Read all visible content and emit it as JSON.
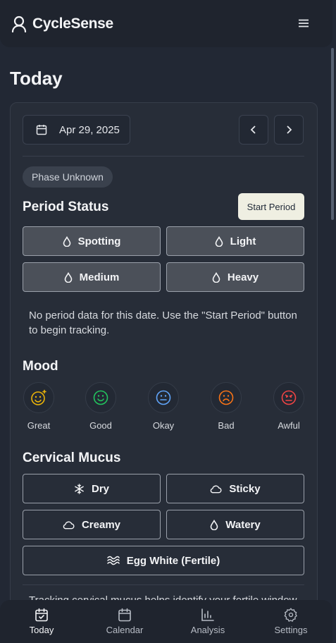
{
  "app": {
    "name": "CycleSense"
  },
  "icons": {
    "logo": "user-icon",
    "menu": "hamburger-icon",
    "calendar": "calendar-icon",
    "prev": "chevron-left-icon",
    "next": "chevron-right-icon",
    "drop": "droplet-icon",
    "snow": "snowflake-icon",
    "cloud": "cloud-icon",
    "waves": "waves-icon"
  },
  "page": {
    "title": "Today"
  },
  "date_selector": {
    "value": "Apr 29, 2025"
  },
  "phase": {
    "label": "Phase Unknown"
  },
  "period": {
    "title": "Period Status",
    "start_button": "Start Period",
    "options": [
      "Spotting",
      "Light",
      "Medium",
      "Heavy"
    ],
    "empty_message": "No period data for this date. Use the \"Start Period\" button to begin tracking."
  },
  "mood": {
    "title": "Mood",
    "options": [
      {
        "label": "Great",
        "color": "#eab308"
      },
      {
        "label": "Good",
        "color": "#22c55e"
      },
      {
        "label": "Okay",
        "color": "#60a5fa"
      },
      {
        "label": "Bad",
        "color": "#f97316"
      },
      {
        "label": "Awful",
        "color": "#ef4444"
      }
    ]
  },
  "mucus": {
    "title": "Cervical Mucus",
    "options": [
      "Dry",
      "Sticky",
      "Creamy",
      "Watery",
      "Egg White (Fertile)"
    ],
    "info_partial": "Tracking cervical mucus helps identify your fertile window"
  },
  "nav": {
    "items": [
      "Today",
      "Calendar",
      "Analysis",
      "Settings"
    ],
    "active": "Today"
  }
}
